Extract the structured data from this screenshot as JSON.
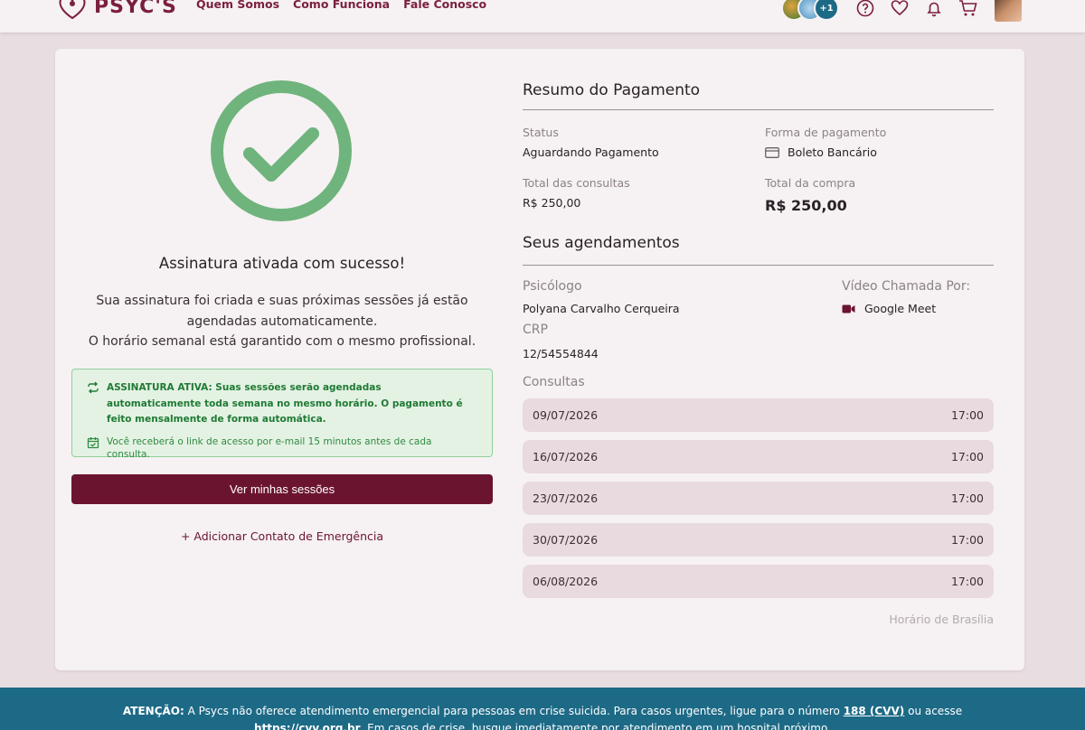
{
  "header": {
    "logo_text": "PSYC'S",
    "nav": [
      "Quem Somos",
      "Como Funciona",
      "Fale Conosco"
    ],
    "avatar_count_badge": "+1"
  },
  "success": {
    "title": "Assinatura ativada com sucesso!",
    "message_line1": "Sua assinatura foi criada e suas próximas sessões já estão",
    "message_line2": "agendadas automaticamente.",
    "message_line3": "O horário semanal está garantido com o mesmo profissional.",
    "info_strong": "ASSINATURA ATIVA: Suas sessões serão agendadas automaticamente toda semana no mesmo horário. O pagamento é feito mensalmente de forma automática.",
    "info_sub": "Você receberá o link de acesso por e-mail 15 minutos antes de cada consulta.",
    "button_label": "Ver minhas sessões",
    "add_emergency_label": "+ Adicionar Contato de Emergência"
  },
  "payment": {
    "title": "Resumo do Pagamento",
    "status_label": "Status",
    "status_value": "Aguardando Pagamento",
    "method_label": "Forma de pagamento",
    "method_value": "Boleto Bancário",
    "total_consultas_label": "Total das consultas",
    "total_consultas_value": "R$ 250,00",
    "total_compra_label": "Total da compra",
    "total_compra_value": "R$ 250,00"
  },
  "appointments": {
    "title": "Seus agendamentos",
    "psychologist_label": "Psicólogo",
    "psychologist_value": "Polyana Carvalho Cerqueira",
    "crp_label": "CRP",
    "crp_value": "12/54554844",
    "video_label": "Vídeo Chamada Por:",
    "video_value": "Google Meet",
    "consultas_label": "Consultas",
    "rows": [
      {
        "date": "09/07/2026",
        "time": "17:00"
      },
      {
        "date": "16/07/2026",
        "time": "17:00"
      },
      {
        "date": "23/07/2026",
        "time": "17:00"
      },
      {
        "date": "30/07/2026",
        "time": "17:00"
      },
      {
        "date": "06/08/2026",
        "time": "17:00"
      }
    ],
    "timezone_note": "Horário de Brasília"
  },
  "footer": {
    "prefix": "ATENÇÃO:",
    "text1": " A Psycs não oferece atendimento emergencial para pessoas em crise suicida. Para casos urgentes, ligue para o número ",
    "cvv_number": "188 (CVV)",
    "text2": " ou acesse",
    "cvv_url": "https://cvv.org.br",
    "text3": ". Em casos de crise, busque imediatamente por atendimento em um hospital próximo."
  },
  "colors": {
    "brand": "#7a1f3d",
    "button": "#6b1430",
    "success_green": "#6fb47c",
    "footer_bg": "#1d6a86"
  }
}
